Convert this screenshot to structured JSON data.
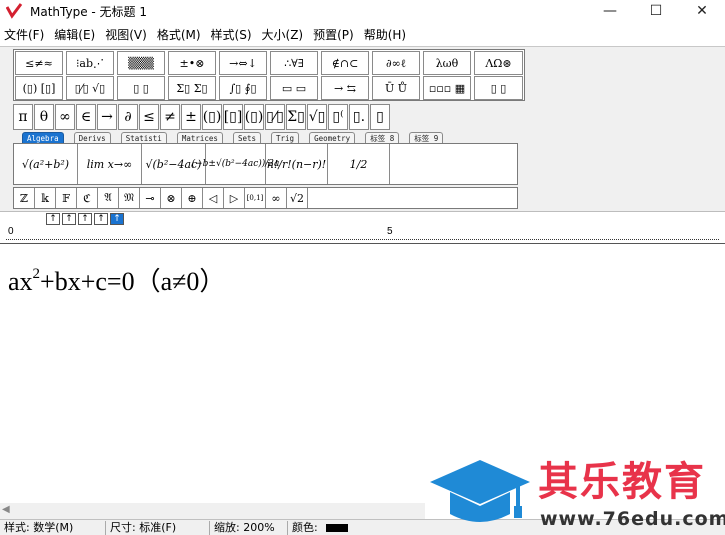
{
  "window": {
    "title": "MathType - 无标题 1",
    "minimize_glyph": "—",
    "maximize_glyph": "☐",
    "close_glyph": "✕"
  },
  "menu": [
    "文件(F)",
    "编辑(E)",
    "视图(V)",
    "格式(M)",
    "样式(S)",
    "大小(Z)",
    "预置(P)",
    "帮助(H)"
  ],
  "palette_row1": [
    "≤≠≈",
    "⁝ab⋰",
    "▒▒▒",
    "±•⊗",
    "→⇔↓",
    "∴∀∃",
    "∉∩⊂",
    "∂∞ℓ",
    "λωθ",
    "ΛΩ⊛"
  ],
  "palette_row2": [
    "(▯) [▯]",
    "▯⁄▯ √▯",
    "▯ ▯",
    "Σ▯ Σ▯",
    "∫▯ ∮▯",
    "▭ ▭",
    "→ ⇆",
    "Ū Ů",
    "▫▫▫ ▦",
    "▯ ▯"
  ],
  "symbols": [
    "π",
    "θ",
    "∞",
    "∈",
    "→",
    "∂",
    "≤",
    "≠",
    "±",
    "(▯)",
    "[▯]",
    "(▯)",
    "▯⁄▯",
    "Σ▯",
    "√▯",
    "▯⁽",
    "▯.",
    "▯"
  ],
  "tabs": [
    "Algebra",
    "Derivs",
    "Statisti",
    "Matrices",
    "Sets",
    "Trig",
    "Geometry",
    "标签 8",
    "标签 9"
  ],
  "templates": [
    "√(a²+b²)",
    "lim x→∞",
    "√(b²−4ac)",
    "(−b±√(b²−4ac))/2a",
    "n!/r!(n−r)!",
    "1/2"
  ],
  "small_symbols": [
    "ℤ",
    "𝕜",
    "𝔽",
    "ℭ",
    "𝔄",
    "𝔐",
    "⊸",
    "⊗",
    "⊕",
    "◁",
    "▷",
    "[0,1]",
    "∞",
    "√2"
  ],
  "nav_buttons": [
    "↑",
    "↑",
    "↑",
    "↑",
    "↑"
  ],
  "ruler": {
    "mark_start": "0",
    "mark_mid": "5"
  },
  "equation": {
    "base": "ax",
    "exponent": "2",
    "rest": "+bx+c=0（a≠0）"
  },
  "status": {
    "style": "样式: 数学(M)",
    "size": "尺寸: 标准(F)",
    "zoom": "缩放: 200%",
    "color_label": "颜色:",
    "color_value": "#000000"
  },
  "watermark": {
    "title": "其乐教育",
    "url": "www.76edu.com",
    "color": "#e8334a",
    "cap_color": "#1f8ad6"
  }
}
